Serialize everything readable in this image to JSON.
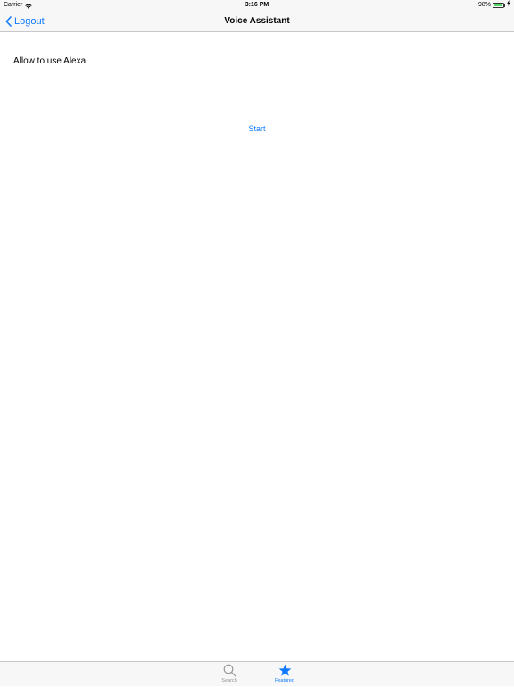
{
  "status_bar": {
    "carrier": "Carrier",
    "time": "3:16 PM",
    "battery_percent": "98%",
    "battery_level": 0.98,
    "battery_color": "#4cd964"
  },
  "nav_bar": {
    "back_label": "Logout",
    "back_icon": "chevron-left-icon",
    "title": "Voice Assistant"
  },
  "content": {
    "label": "Allow to use Alexa",
    "start_label": "Start"
  },
  "tab_bar": {
    "items": [
      {
        "label": "Search",
        "icon": "magnifier-icon",
        "selected": false
      },
      {
        "label": "Featured",
        "icon": "star-icon",
        "selected": true
      }
    ]
  },
  "colors": {
    "accent": "#0f7aff",
    "inactive": "#929292",
    "bar_background": "#f7f7f7",
    "separator": "#c8c7cc"
  }
}
